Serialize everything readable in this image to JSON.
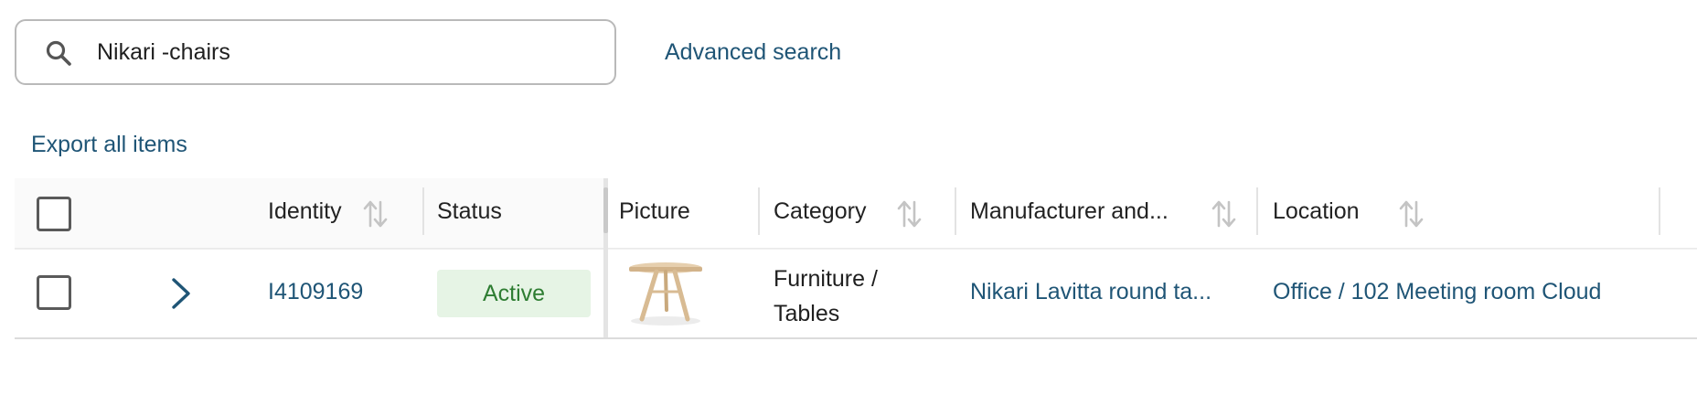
{
  "search": {
    "value": "Nikari -chairs",
    "icon": "search-icon"
  },
  "advanced_search_label": "Advanced search",
  "export_label": "Export all items",
  "colors": {
    "link": "#1f5576",
    "status_active_bg": "#e6f4e5",
    "status_active_text": "#2e7d32",
    "border": "#b9b9b9"
  },
  "table": {
    "columns": [
      "Identity",
      "Status",
      "Picture",
      "Category",
      "Manufacturer and...",
      "Location"
    ],
    "rows": [
      {
        "identity": "I4109169",
        "status": "Active",
        "picture_icon": "round-table-image",
        "category_line1": "Furniture /",
        "category_line2": "Tables",
        "manufacturer": "Nikari Lavitta round ta...",
        "location": "Office / 102 Meeting room Cloud"
      }
    ]
  }
}
